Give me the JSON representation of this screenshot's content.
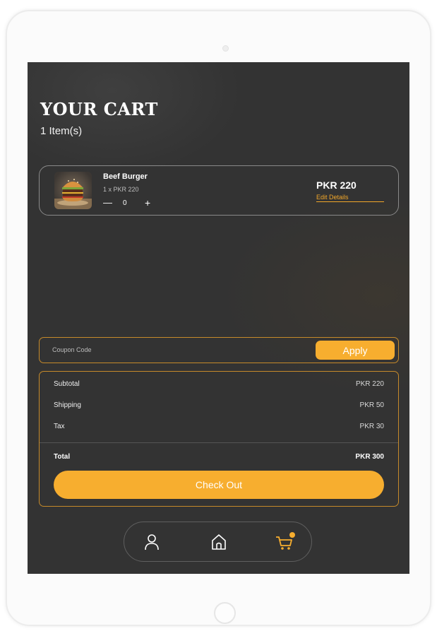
{
  "cart": {
    "title": "YOUR CART",
    "item_count": "1 Item(s)"
  },
  "items": [
    {
      "name": "Beef Burger",
      "qty_price": "1 x PKR 220",
      "quantity": "0",
      "minus": "—",
      "plus": "+",
      "price": "PKR 220",
      "edit_label": "Edit Details",
      "image": "burger-image"
    }
  ],
  "coupon": {
    "placeholder": "Coupon Code",
    "apply_label": "Apply"
  },
  "summary": {
    "subtotal_label": "Subtotal",
    "subtotal_value": "PKR 220",
    "shipping_label": "Shipping",
    "shipping_value": "PKR 50",
    "tax_label": "Tax",
    "tax_value": "PKR 30",
    "total_label": "Total",
    "total_value": "PKR 300",
    "checkout_label": "Check Out"
  },
  "nav": {
    "items": [
      {
        "icon": "profile-icon"
      },
      {
        "icon": "home-icon"
      },
      {
        "icon": "cart-icon",
        "badge": true,
        "active": true
      }
    ]
  },
  "colors": {
    "accent": "#f7ae2f",
    "screen_bg": "#333333",
    "border_accent": "#c68a2a"
  }
}
